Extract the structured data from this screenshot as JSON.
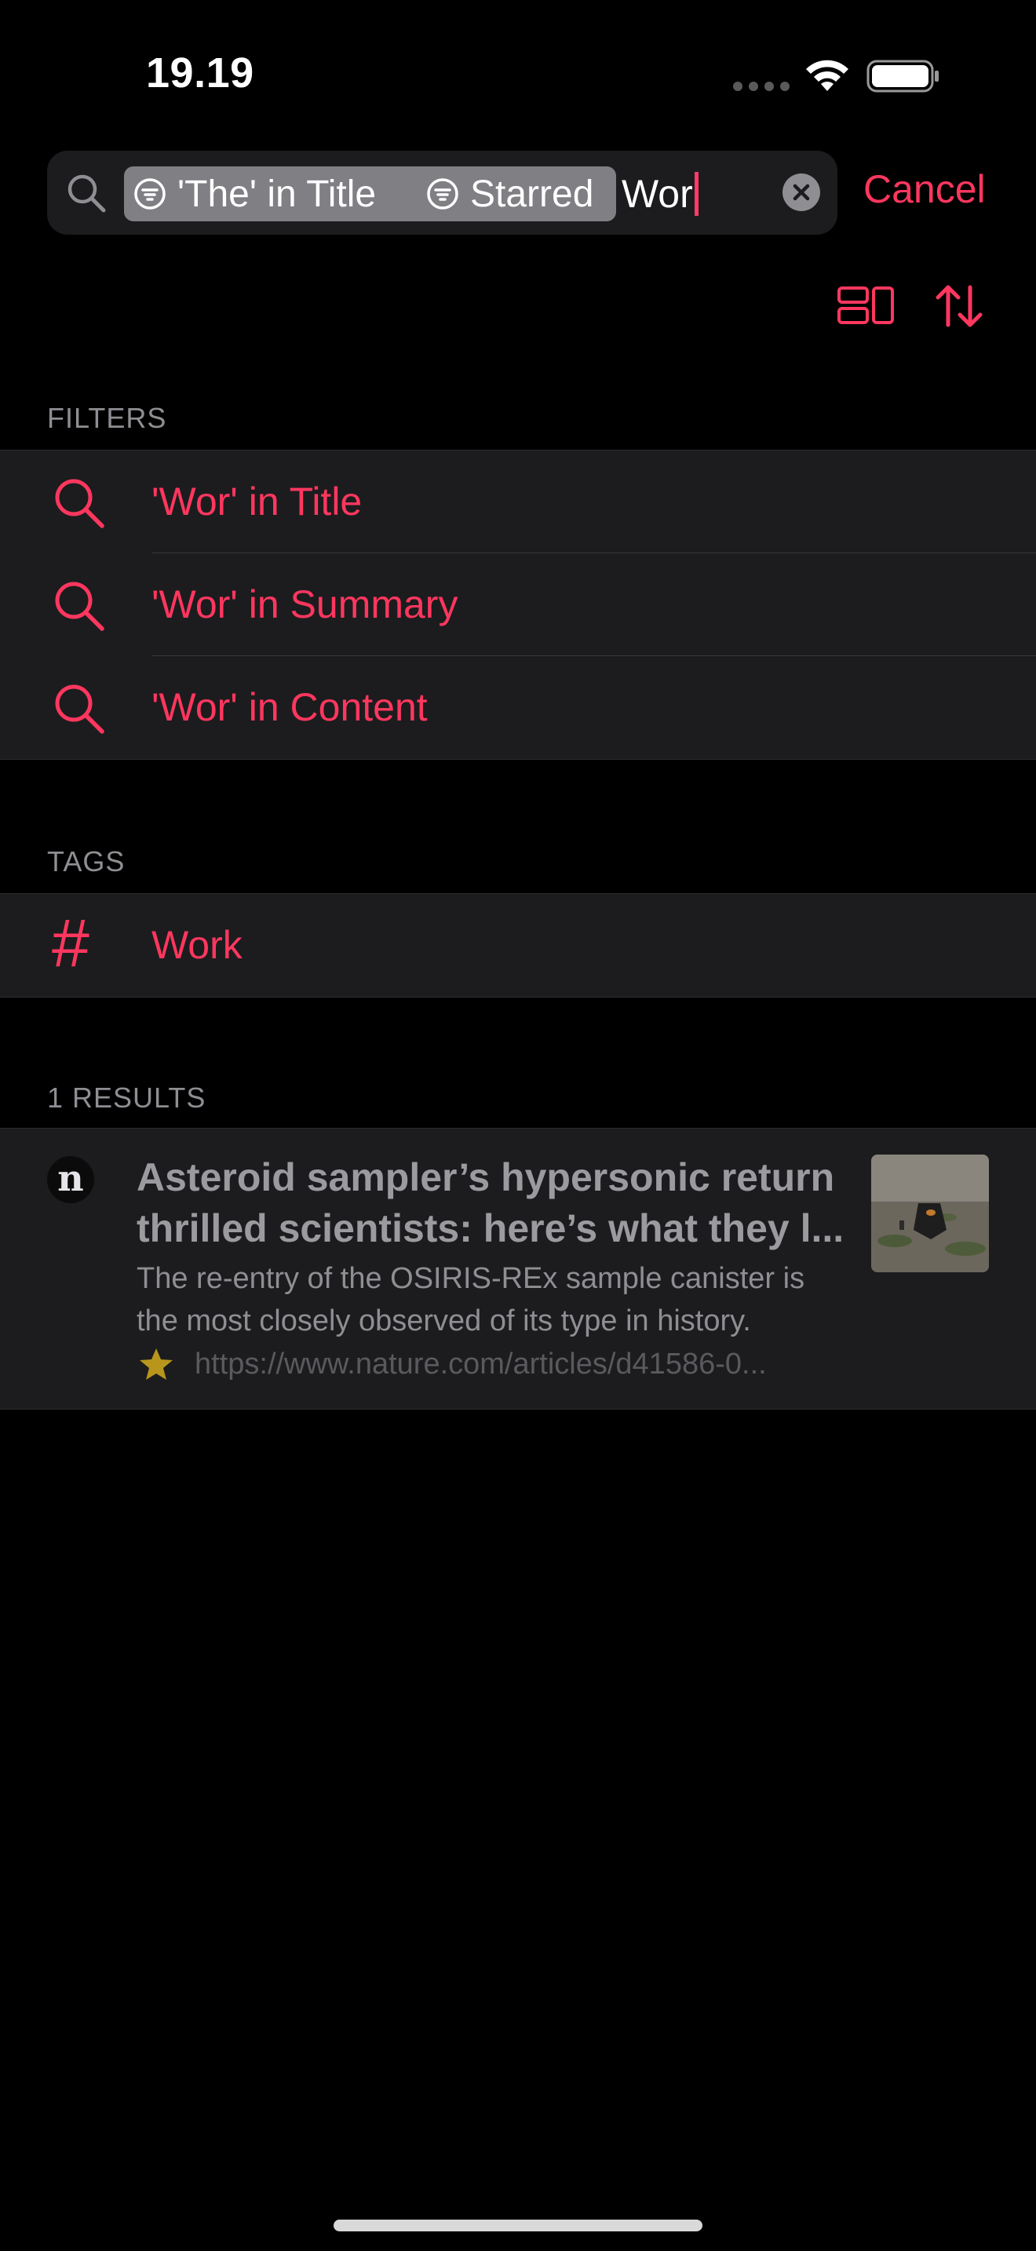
{
  "status_bar": {
    "time": "19.19"
  },
  "search": {
    "tokens": [
      {
        "label": "'The' in Title",
        "icon": "filter-icon"
      },
      {
        "label": "Starred",
        "icon": "filter-icon"
      }
    ],
    "query": "Wor",
    "cancel_label": "Cancel"
  },
  "toolbar": {
    "layout_icon": "layout-toggle-icon",
    "sort_icon": "sort-icon"
  },
  "sections": {
    "filters_header": "FILTERS",
    "tags_header": "TAGS",
    "results_header": "1 RESULTS"
  },
  "filters": [
    {
      "label": "'Wor' in Title",
      "icon": "search-icon"
    },
    {
      "label": "'Wor' in Summary",
      "icon": "search-icon"
    },
    {
      "label": "'Wor' in Content",
      "icon": "search-icon"
    }
  ],
  "tags": [
    {
      "label": "Work",
      "icon": "hashtag-icon",
      "glyph": "#"
    }
  ],
  "results": [
    {
      "site_badge": "n",
      "title_line1": "Asteroid sampler’s hypersonic return",
      "title_line2": "thrilled scientists: here’s what they l...",
      "summary_line1": "The re-entry of the OSIRIS-REx sample canister is",
      "summary_line2": "the most closely observed of its type in history.",
      "starred": true,
      "url": "https://www.nature.com/articles/d41586-0..."
    }
  ],
  "colors": {
    "accent": "#ff375f",
    "background": "#000000",
    "cell_background": "#1c1c1e",
    "secondary_text": "#8e8e93",
    "star": "#b8961c"
  }
}
